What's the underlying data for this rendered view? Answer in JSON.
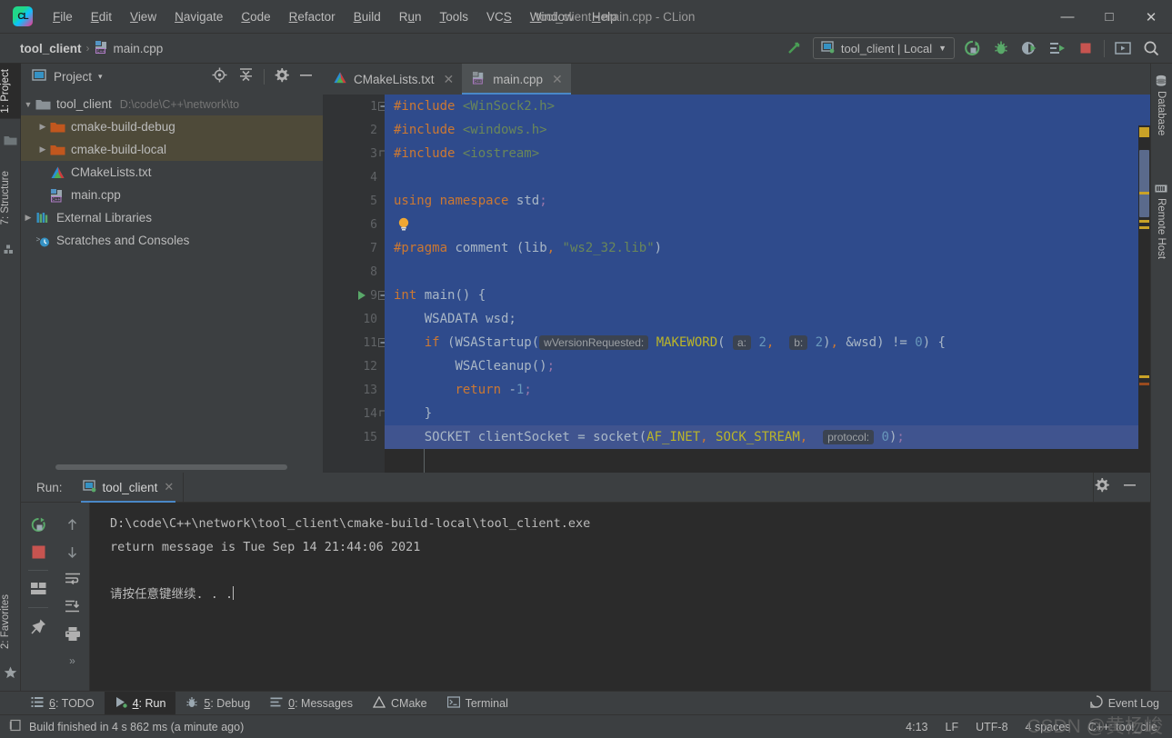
{
  "window": {
    "title": "tool_client - main.cpp - CLion",
    "logo_text": "CL",
    "minimize": "—",
    "maximize": "□",
    "close": "✕"
  },
  "menubar": {
    "items": [
      "File",
      "Edit",
      "View",
      "Navigate",
      "Code",
      "Refactor",
      "Build",
      "Run",
      "Tools",
      "VCS",
      "Window",
      "Help"
    ]
  },
  "navbar": {
    "crumbs": [
      "tool_client",
      "main.cpp"
    ],
    "separator": "›",
    "run_config": "tool_client | Local",
    "icons": [
      "build-icon",
      "run-icon",
      "debug-icon",
      "run-with-coverage-icon",
      "profile-icon",
      "stop-icon",
      "terminal-icon",
      "search-everywhere-icon"
    ]
  },
  "left_strip": {
    "tabs": [
      "1: Project",
      "7: Structure",
      "2: Favorites"
    ]
  },
  "right_strip": {
    "tabs": [
      "Database",
      "Remote Host"
    ]
  },
  "project_panel": {
    "title": "Project",
    "dropdown": "▾",
    "actions": [
      "locate-icon",
      "collapse-all-icon",
      "settings-icon",
      "hide-icon"
    ],
    "tree": [
      {
        "label": "tool_client",
        "path": "D:\\code\\C++\\network\\to",
        "icon": "folder-module-icon",
        "arrow": "▼",
        "indent": 0,
        "selected": false
      },
      {
        "label": "cmake-build-debug",
        "path": "",
        "icon": "folder-excluded-icon",
        "arrow": "▶",
        "indent": 1,
        "selected": true
      },
      {
        "label": "cmake-build-local",
        "path": "",
        "icon": "folder-excluded-icon",
        "arrow": "▶",
        "indent": 1,
        "selected": true
      },
      {
        "label": "CMakeLists.txt",
        "path": "",
        "icon": "cmake-icon",
        "arrow": "",
        "indent": 1,
        "selected": false
      },
      {
        "label": "main.cpp",
        "path": "",
        "icon": "cpp-file-icon",
        "arrow": "",
        "indent": 1,
        "selected": false
      },
      {
        "label": "External Libraries",
        "path": "",
        "icon": "libraries-icon",
        "arrow": "▶",
        "indent": 0,
        "selected": false
      },
      {
        "label": "Scratches and Consoles",
        "path": "",
        "icon": "scratches-icon",
        "arrow": "",
        "indent": 0,
        "selected": false
      }
    ]
  },
  "editor": {
    "tabs": [
      {
        "label": "CMakeLists.txt",
        "icon": "cmake-icon",
        "active": false,
        "close": "✕"
      },
      {
        "label": "main.cpp",
        "icon": "cpp-file-icon",
        "active": true,
        "close": "✕"
      }
    ],
    "line_numbers": [
      "1",
      "2",
      "3",
      "4",
      "5",
      "6",
      "7",
      "8",
      "9",
      "10",
      "11",
      "12",
      "13",
      "14",
      "15"
    ],
    "code_lines": [
      {
        "n": 1,
        "html": "<span class=\"kw\">#include</span> <span class=\"inc\">&lt;WinSock2.h&gt;</span>",
        "sel": true
      },
      {
        "n": 2,
        "html": "<span class=\"kw\">#include</span> <span class=\"inc\">&lt;windows.h&gt;</span>",
        "sel": true
      },
      {
        "n": 3,
        "html": "<span class=\"kw\">#include</span> <span class=\"inc\">&lt;iostream&gt;</span>",
        "sel": true
      },
      {
        "n": 4,
        "html": "",
        "sel": true
      },
      {
        "n": 5,
        "html": "<span class=\"kw\">using</span> <span class=\"kw\">namespace</span> <span class=\"txt\">std</span><span class=\"cst\">;</span>",
        "sel": true
      },
      {
        "n": 6,
        "html": "",
        "sel": true
      },
      {
        "n": 7,
        "html": "<span class=\"kw\">#pragma</span> <span class=\"txt\">comment</span> <span class=\"txt\">(</span><span class=\"txt\">lib</span><span class=\"kw\">,</span> <span class=\"str\">\"ws2_32.lib\"</span><span class=\"txt\">)</span>",
        "sel": true
      },
      {
        "n": 8,
        "html": "",
        "sel": true
      },
      {
        "n": 9,
        "html": "<span class=\"kw\">int</span> <span class=\"txt\">main() {</span>",
        "sel": true
      },
      {
        "n": 10,
        "html": "    <span class=\"txt\">WSADATA wsd;</span>",
        "sel": true
      },
      {
        "n": 11,
        "html": "    <span class=\"kw\">if</span> <span class=\"txt\">(WSAStartup(</span><span class=\"hint\">wVersionRequested:</span> <span class=\"mac\">MAKEWORD</span><span class=\"txt\">(</span> <span class=\"hint\">a:</span> <span class=\"num\">2</span><span class=\"kw\">,</span>  <span class=\"hint\">b:</span> <span class=\"num\">2</span><span class=\"txt\">)</span><span class=\"kw\">,</span> <span class=\"txt\">&amp;wsd) != </span><span class=\"num\">0</span><span class=\"txt\">) {</span>",
        "sel": true
      },
      {
        "n": 12,
        "html": "        <span class=\"txt\">WSACleanup()</span><span class=\"cst\">;</span>",
        "sel": true
      },
      {
        "n": 13,
        "html": "        <span class=\"kw\">return</span> <span class=\"txt\">-</span><span class=\"num\">1</span><span class=\"cst\">;</span>",
        "sel": true
      },
      {
        "n": 14,
        "html": "    <span class=\"txt\">}</span>",
        "sel": true
      },
      {
        "n": 15,
        "html": "    <span class=\"txt\">SOCKET clientSocket = socket(</span><span class=\"mac\">AF_INET</span><span class=\"kw\">,</span> <span class=\"mac\">SOCK_STREAM</span><span class=\"kw\">,</span>  <span class=\"hint\">protocol:</span> <span class=\"num\">0</span><span class=\"txt\">)</span><span class=\"cst\">;</span>",
        "sel": false
      }
    ],
    "gutter_icons": {
      "run_line": 9,
      "bulb_line": 6,
      "bulb": "intention-bulb-icon",
      "run": "run-gutter-icon"
    }
  },
  "run_panel": {
    "label": "Run:",
    "tab": "tool_client",
    "tab_close": "✕",
    "left_buttons": [
      "rerun-icon",
      "stop-icon",
      "layout-icon",
      "pin-icon"
    ],
    "right_buttons": [
      "up-icon",
      "down-icon",
      "soft-wrap-icon",
      "scroll-to-end-icon",
      "print-icon",
      "more-icon"
    ],
    "settings_icon": "gear-icon",
    "hide_icon": "hide-icon",
    "console_lines": [
      "D:\\code\\C++\\network\\tool_client\\cmake-build-local\\tool_client.exe",
      "return message is Tue Sep 14 21:44:06 2021",
      "",
      "请按任意键继续. . ."
    ]
  },
  "tool_windows": {
    "items": [
      {
        "label": "6: TODO",
        "icon": "todo-icon",
        "active": false,
        "mnemonic": "6"
      },
      {
        "label": "4: Run",
        "icon": "run-icon",
        "active": true,
        "mnemonic": "4"
      },
      {
        "label": "5: Debug",
        "icon": "debug-icon",
        "active": false,
        "mnemonic": "5"
      },
      {
        "label": "0: Messages",
        "icon": "messages-icon",
        "active": false,
        "mnemonic": "0"
      },
      {
        "label": "CMake",
        "icon": "cmake-icon",
        "active": false,
        "mnemonic": ""
      },
      {
        "label": "Terminal",
        "icon": "terminal-icon",
        "active": false,
        "mnemonic": ""
      }
    ],
    "event_log": "Event Log",
    "event_log_icon": "event-log-icon"
  },
  "status_bar": {
    "message": "Build finished in 4 s 862 ms (a minute ago)",
    "message_icon": "build-status-icon",
    "caret_position": "4:13",
    "line_separator": "LF",
    "encoding": "UTF-8",
    "indent": "4 spaces",
    "language": "C++: tool_clie",
    "watermark": "CSDN @黄杨峻"
  },
  "colors": {
    "accent_blue": "#4a88c7",
    "selection_blue": "#2f4b8c",
    "panel_bg": "#3c3f41",
    "editor_bg": "#2b2b2b",
    "selected_tree": "#4e4a39",
    "green": "#499c54",
    "red": "#c75450",
    "warning_yellow": "#c9a227"
  }
}
